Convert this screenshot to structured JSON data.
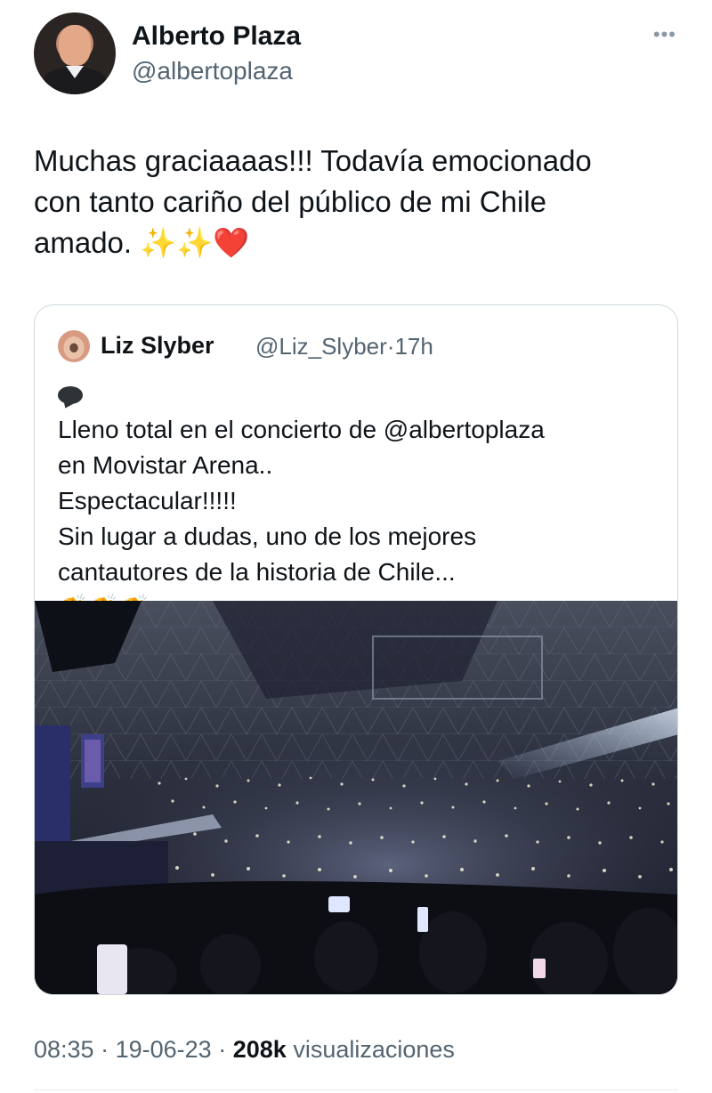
{
  "tweet": {
    "author_name": "Alberto Plaza",
    "author_handle": "@albertoplaza",
    "more_icon": "more-horizontal-icon",
    "text_lines": [
      "Muchas graciaaaas!!! Todavía emocionado",
      "con tanto cariño del público de mi Chile",
      "amado. ✨✨❤️"
    ],
    "time": "08:35",
    "date": "19-06-23",
    "separator": "·",
    "views_count": "208k",
    "views_label": "visualizaciones"
  },
  "quote": {
    "author_name": "Liz Slyber",
    "author_handle": "@Liz_Slyber",
    "separator": "·",
    "age": "17h",
    "lines": [
      "Lleno total en el concierto de @albertoplaza",
      "en Movistar Arena..",
      "Espectacular!!!!!",
      "Sin lugar a dudas, uno de los mejores",
      "cantautores de la historia de Chile..."
    ],
    "trailing_claps": "👏👏👏",
    "claps_line": "👏👏"
  },
  "colors": {
    "text": "#0f1419",
    "secondary": "#536471",
    "border": "#cfd9de"
  }
}
